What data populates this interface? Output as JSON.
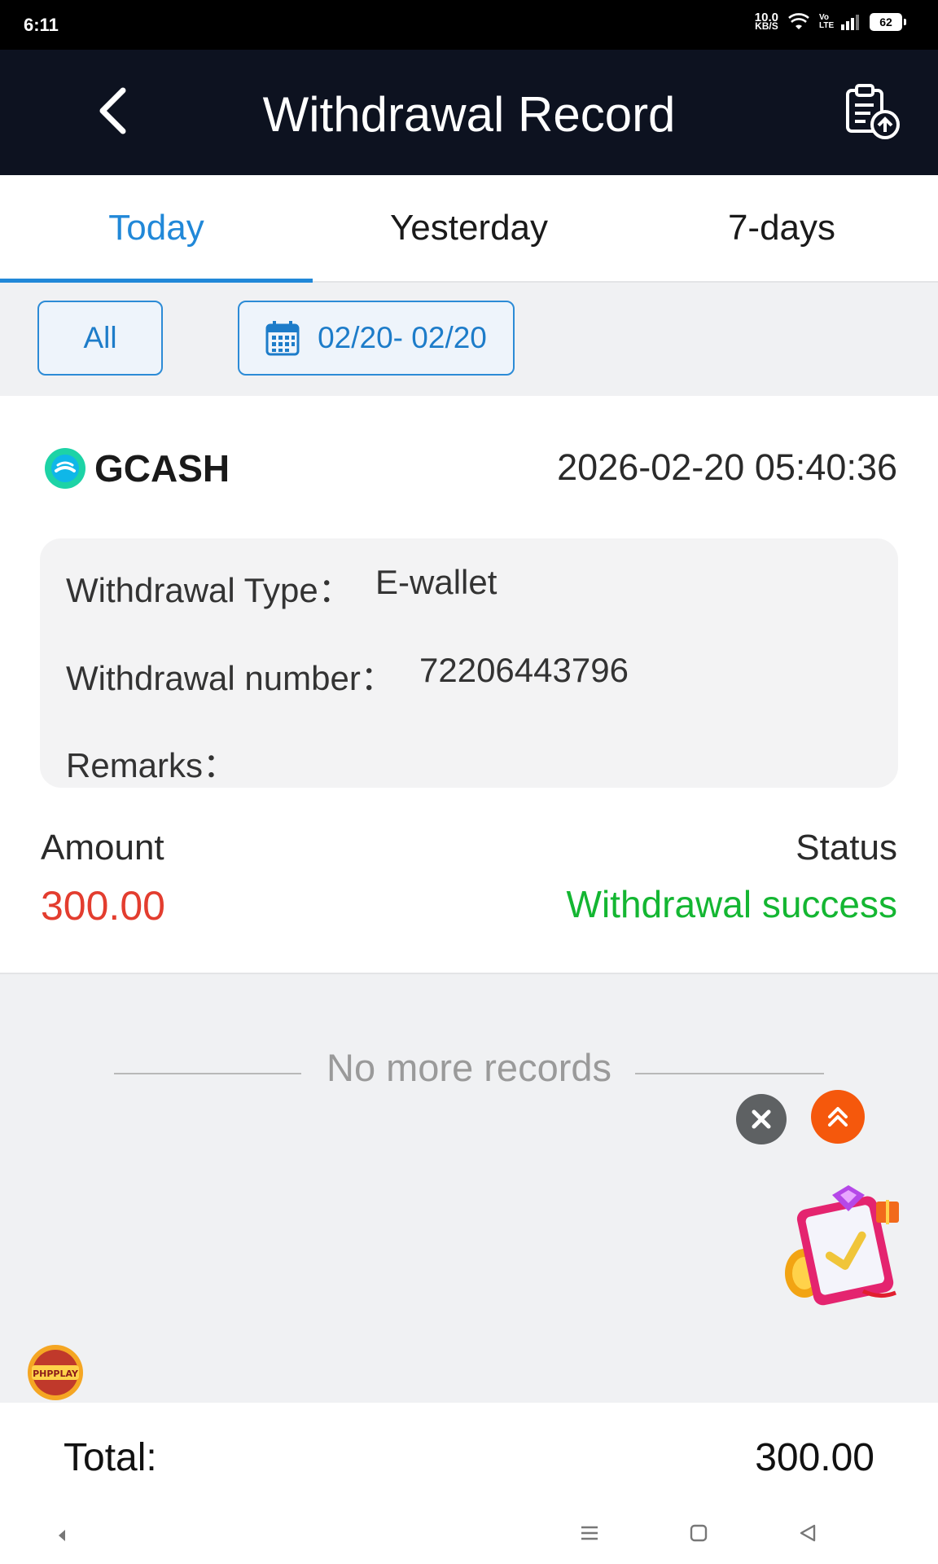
{
  "status_bar": {
    "time": "6:11",
    "net_speed_value": "10.0",
    "net_speed_unit": "KB/S",
    "volte": "Vo LTE",
    "battery": "62"
  },
  "header": {
    "title": "Withdrawal Record"
  },
  "tabs": [
    {
      "label": "Today",
      "active": true
    },
    {
      "label": "Yesterday",
      "active": false
    },
    {
      "label": "7-days",
      "active": false
    }
  ],
  "filters": {
    "all_label": "All",
    "date_range": "02/20- 02/20"
  },
  "record": {
    "provider": "GCASH",
    "datetime": "2026-02-20 05:40:36",
    "type_label": "Withdrawal Type：",
    "type_value": "E-wallet",
    "number_label": "Withdrawal number：",
    "number_value": "72206443796",
    "remarks_label": "Remarks：",
    "amount_label": "Amount",
    "amount_value": "300.00",
    "status_label": "Status",
    "status_value": "Withdrawal success"
  },
  "list_end_text": "No more records",
  "floating": {
    "badge_text": "PHPPLAY"
  },
  "footer": {
    "total_label": "Total:",
    "total_value": "300.00"
  },
  "colors": {
    "accent": "#2188d8",
    "amount": "#e33d2f",
    "success": "#14b632",
    "header_bg": "#0d1220"
  }
}
